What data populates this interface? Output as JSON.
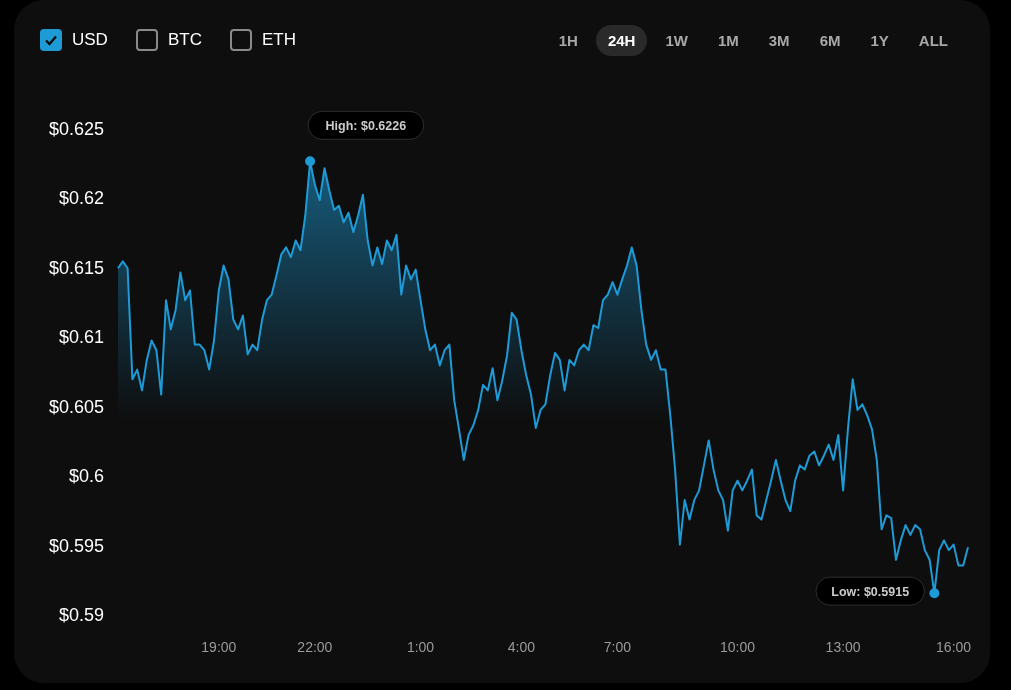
{
  "currencies": [
    {
      "label": "USD",
      "checked": true
    },
    {
      "label": "BTC",
      "checked": false
    },
    {
      "label": "ETH",
      "checked": false
    }
  ],
  "ranges": [
    {
      "label": "1H",
      "selected": false
    },
    {
      "label": "24H",
      "selected": true
    },
    {
      "label": "1W",
      "selected": false
    },
    {
      "label": "1M",
      "selected": false
    },
    {
      "label": "3M",
      "selected": false
    },
    {
      "label": "6M",
      "selected": false
    },
    {
      "label": "1Y",
      "selected": false
    },
    {
      "label": "ALL",
      "selected": false
    }
  ],
  "chart_data": {
    "type": "area",
    "categories": [
      null,
      null,
      null,
      null,
      null,
      null,
      null,
      null,
      null,
      null,
      null,
      null,
      null,
      null,
      null,
      null,
      null,
      null,
      null,
      null,
      null,
      "19:00",
      null,
      null,
      null,
      null,
      null,
      null,
      null,
      null,
      null,
      null,
      null,
      null,
      null,
      null,
      null,
      null,
      null,
      null,
      null,
      "22:00",
      null,
      null,
      null,
      null,
      null,
      null,
      null,
      null,
      null,
      null,
      null,
      null,
      null,
      null,
      null,
      null,
      null,
      null,
      null,
      null,
      null,
      "1:00",
      null,
      null,
      null,
      null,
      null,
      null,
      null,
      null,
      null,
      null,
      null,
      null,
      null,
      null,
      null,
      null,
      null,
      null,
      null,
      null,
      "4:00",
      null,
      null,
      null,
      null,
      null,
      null,
      null,
      null,
      null,
      null,
      null,
      null,
      null,
      null,
      null,
      null,
      null,
      null,
      null,
      "7:00",
      null,
      null,
      null,
      null,
      null,
      null,
      null,
      null,
      null,
      null,
      null,
      null,
      null,
      null,
      null,
      null,
      null,
      null,
      null,
      null,
      null,
      null,
      null,
      null,
      "10:00",
      null,
      null,
      null,
      null,
      null,
      null,
      null,
      null,
      null,
      null,
      null,
      null,
      null,
      null,
      null,
      null,
      null,
      null,
      null,
      null,
      null,
      "13:00",
      null,
      null,
      null,
      null,
      null,
      null,
      null,
      null,
      null,
      null,
      null,
      null,
      null,
      null,
      null,
      null,
      null,
      null,
      null,
      null,
      null,
      null,
      "16:00",
      null,
      null,
      null
    ],
    "series": [
      {
        "color": "#1e9bd7",
        "values": [
          0.6149,
          0.6154,
          0.6149,
          0.6069,
          0.6076,
          0.6061,
          0.6083,
          0.6097,
          0.609,
          0.6058,
          0.6126,
          0.6105,
          0.6119,
          0.6146,
          0.6126,
          0.6133,
          0.6094,
          0.6094,
          0.609,
          0.6076,
          0.6097,
          0.6133,
          0.6151,
          0.6141,
          0.6112,
          0.6105,
          0.6115,
          0.6087,
          0.6094,
          0.609,
          0.6112,
          0.6126,
          0.613,
          0.6144,
          0.6159,
          0.6164,
          0.6157,
          0.6169,
          0.6162,
          0.6187,
          0.6226,
          0.6209,
          0.6198,
          0.6221,
          0.6205,
          0.6191,
          0.6194,
          0.6182,
          0.6189,
          0.6175,
          0.6187,
          0.6202,
          0.6169,
          0.6151,
          0.6164,
          0.6152,
          0.6169,
          0.6162,
          0.6173,
          0.613,
          0.6151,
          0.6141,
          0.6148,
          0.6126,
          0.6105,
          0.609,
          0.6094,
          0.6079,
          0.609,
          0.6094,
          0.6054,
          0.6033,
          0.6011,
          0.6029,
          0.6036,
          0.6047,
          0.6065,
          0.6061,
          0.6077,
          0.6054,
          0.6068,
          0.6086,
          0.6117,
          0.6112,
          0.609,
          0.6072,
          0.6058,
          0.6034,
          0.6047,
          0.6051,
          0.6072,
          0.6088,
          0.6083,
          0.6061,
          0.6083,
          0.6079,
          0.609,
          0.6094,
          0.609,
          0.6108,
          0.6106,
          0.6126,
          0.613,
          0.6139,
          0.613,
          0.6141,
          0.6151,
          0.6164,
          0.6151,
          0.6119,
          0.6094,
          0.6083,
          0.609,
          0.6076,
          0.6076,
          0.6043,
          0.6004,
          0.595,
          0.5982,
          0.5968,
          0.5982,
          0.5989,
          0.6007,
          0.6025,
          0.6004,
          0.5989,
          0.5982,
          0.596,
          0.5989,
          0.5996,
          0.5989,
          0.5996,
          0.6004,
          0.5971,
          0.5968,
          0.5982,
          0.5996,
          0.6011,
          0.5996,
          0.5982,
          0.5974,
          0.5996,
          0.6007,
          0.6004,
          0.6014,
          0.6017,
          0.6007,
          0.6014,
          0.6022,
          0.6011,
          0.6029,
          0.5989,
          0.6033,
          0.6069,
          0.6047,
          0.6051,
          0.6043,
          0.6033,
          0.6011,
          0.5961,
          0.5971,
          0.5969,
          0.5939,
          0.5953,
          0.5964,
          0.5957,
          0.5964,
          0.5961,
          0.5946,
          0.5939,
          0.5915,
          0.5946,
          0.5953,
          0.5946,
          0.595,
          0.5935,
          0.5935,
          0.5948
        ]
      }
    ],
    "ylim": [
      0.59,
      0.625
    ],
    "yticks": [
      {
        "value": 0.625,
        "label": "$0.625"
      },
      {
        "value": 0.62,
        "label": "$0.62"
      },
      {
        "value": 0.615,
        "label": "$0.615"
      },
      {
        "value": 0.61,
        "label": "$0.61"
      },
      {
        "value": 0.605,
        "label": "$0.605"
      },
      {
        "value": 0.6,
        "label": "$0.6"
      },
      {
        "value": 0.595,
        "label": "$0.595"
      },
      {
        "value": 0.59,
        "label": "$0.59"
      }
    ],
    "annotations": [
      "High: $0.6226",
      "Low: $0.5915"
    ]
  }
}
